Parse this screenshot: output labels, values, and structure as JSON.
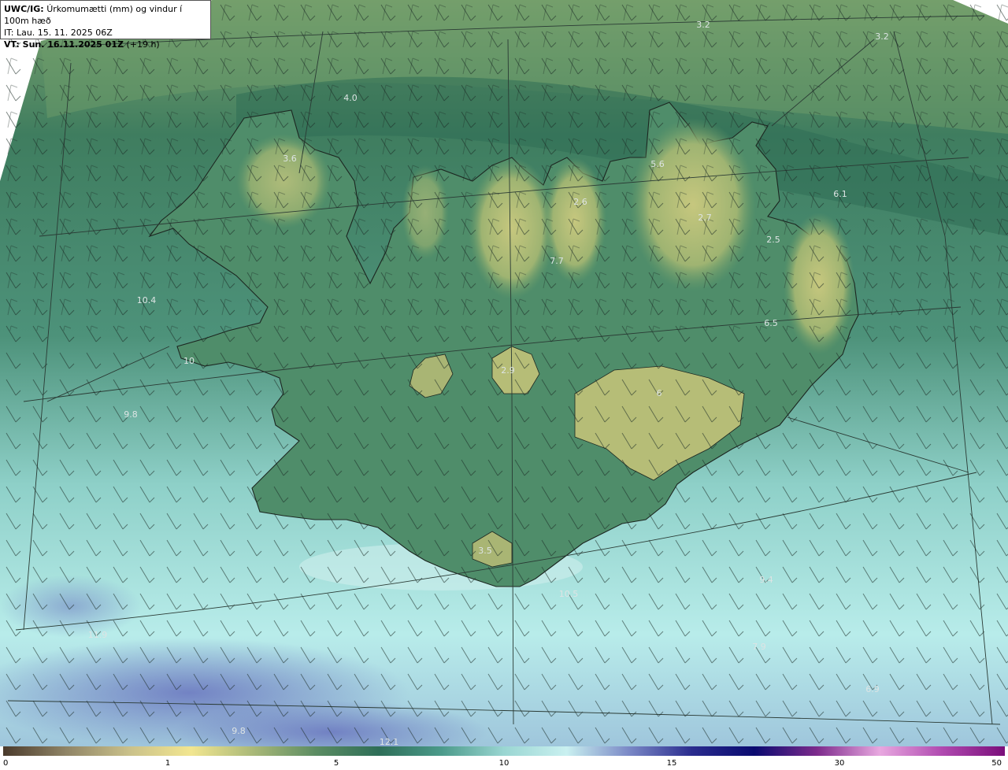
{
  "header": {
    "model": "UWC/IG:",
    "title": "Úrkomumætti (mm) og vindur í 100m hæð",
    "it_line": "IT: Lau. 15. 11. 2025 06Z",
    "vt_prefix": "VT: Sun. 16.11.2025 01Z",
    "vt_suffix": "(+19 h)"
  },
  "map_labels": [
    "3.2",
    "3.2",
    "4.0",
    "3.6",
    "5.6",
    "6.1",
    "2.6",
    "2.7",
    "2.5",
    "7.7",
    "10.4",
    "6.5",
    "10",
    "2.9",
    "6",
    "9.8",
    "3.5",
    "9.4",
    "10.5",
    "11.9",
    "7.9",
    "6.9",
    "9.8",
    "12.1"
  ],
  "colorbar": {
    "ticks": [
      "0",
      "1",
      "5",
      "10",
      "15",
      "30",
      "50"
    ],
    "colors": [
      "#4a3a2c",
      "#8f8466",
      "#c9c08a",
      "#f2e690",
      "#a9b878",
      "#5b8c62",
      "#2e6e58",
      "#4b9a8a",
      "#9ad6d2",
      "#c9f0f0",
      "#7a88c6",
      "#2a2c8e",
      "#0a0a70",
      "#7d2b8c",
      "#e8a8e0",
      "#b04ab0",
      "#7a0e7a"
    ]
  },
  "colors": {
    "sea_north": "#6f9a6a",
    "sea_mid": "#3c7c62",
    "sea_south": "#a8e4e2",
    "land_high": "#b8c07a",
    "land_low": "#4f8e6a"
  }
}
